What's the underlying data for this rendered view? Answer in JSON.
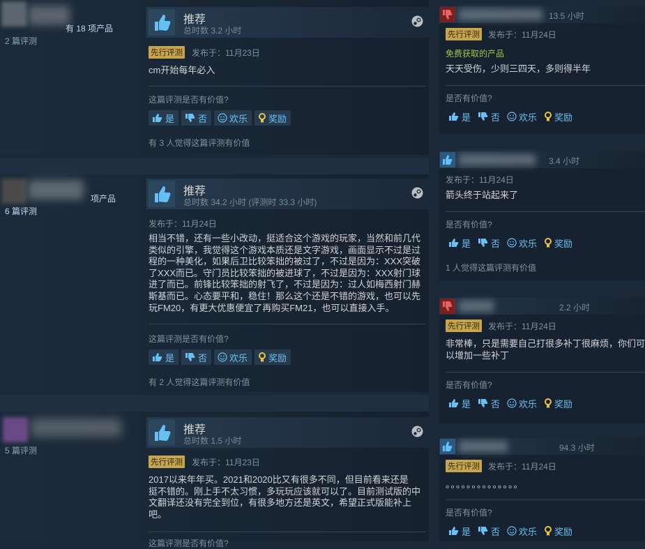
{
  "colors": {
    "accent": "#67c1f5",
    "early_access": "#c6a54e",
    "free": "#a4c34d",
    "thumb_up": "#2a5a82",
    "thumb_down": "#7a1f1f"
  },
  "left_reviews": [
    {
      "author_nick": "有 18 项产品",
      "review_count": "2 篇评测",
      "recommendation": "推荐",
      "hours": "总时数 3.2 小时",
      "early_access": "先行评测",
      "posted": "发布于：11月23日",
      "body": [
        "cm开始每年必入"
      ],
      "helpful_question": "这篇评测是否有价值?",
      "buttons": {
        "yes": "是",
        "no": "否",
        "funny": "欢乐",
        "award": "奖励"
      },
      "helpful_count": "有 3 人觉得这篇评测有价值"
    },
    {
      "author_nick": "项产品",
      "review_count": "6 篇评测",
      "recommendation": "推荐",
      "hours": "总时数 34.2 小时   (评测时 33.3 小时)",
      "early_access": "",
      "posted": "发布于：11月24日",
      "body": [
        "相当不错，还有一些小改动，挺适合这个游戏的玩家，当然和前几代",
        "类似的引擎，我觉得这个游戏本质还是文字游戏，画面显示不过是过",
        "程的一种美化，如果后卫比较笨拙的被过了，不过是因为：XXX突破",
        "了XXX而已。守门员比较笨拙的被进球了，不过是因为：XXX射门球",
        "进了而已。前锋比较笨拙的射飞了，不过是因为：过人如梅西射门赫",
        "斯基而已。心态要平和，稳住！那么这个还是不错的游戏，也可以先",
        "玩FM20，有更大优惠便宜了再购买FM21，也可以直接入手。"
      ],
      "helpful_question": "这篇评测是否有价值?",
      "buttons": {
        "yes": "是",
        "no": "否",
        "funny": "欢乐",
        "award": "奖励"
      },
      "helpful_count": "有 2 人觉得这篇评测有价值"
    },
    {
      "author_nick": "",
      "review_count": "5 篇评测",
      "recommendation": "推荐",
      "hours": "总时数 1.5 小时",
      "early_access": "先行评测",
      "posted": "发布于：11月23日",
      "body": [
        "2017以来年年买。2021和2020比又有很多不同，但目前看来还是",
        "挺不错的。刚上手不太习惯，多玩玩应该就可以了。目前测试版的中",
        "文翻译还没有完全到位，有很多地方还是英文，希望正式版能补上",
        "吧。"
      ],
      "helpful_question": "这篇评测是否有价值?",
      "buttons": {
        "yes": "是",
        "no": "否",
        "funny": "欢乐",
        "award": "奖励"
      },
      "helpful_count": ""
    }
  ],
  "right_reviews": [
    {
      "thumb": "down",
      "hours": "13.5 小时",
      "early_access": "先行评测",
      "posted": "发布于：11月24日",
      "free_label": "免费获取的产品",
      "body": [
        "天天受伤，少则三四天，多则得半年"
      ],
      "helpful_question": "是否有价值?",
      "buttons": {
        "yes": "是",
        "no": "否",
        "funny": "欢乐",
        "award": "奖励"
      },
      "helpful_count": ""
    },
    {
      "thumb": "up",
      "hours": "3.4 小时",
      "early_access": "",
      "posted": "发布于：11月24日",
      "free_label": "",
      "body": [
        "箭头终于站起来了"
      ],
      "helpful_question": "是否有价值?",
      "buttons": {
        "yes": "是",
        "no": "否",
        "funny": "欢乐",
        "award": "奖励"
      },
      "helpful_count": "1 人觉得这篇评测有价值"
    },
    {
      "thumb": "down",
      "hours": "2.2 小时",
      "early_access": "先行评测",
      "posted": "发布于：11月24日",
      "free_label": "",
      "body": [
        "非常棒，只是需要自己打很多补丁很麻烦，你们可",
        "以增加一些补丁"
      ],
      "helpful_question": "是否有价值?",
      "buttons": {
        "yes": "是",
        "no": "否",
        "funny": "欢乐",
        "award": "奖励"
      },
      "helpful_count": ""
    },
    {
      "thumb": "up",
      "hours": "94.3 小时",
      "early_access": "先行评测",
      "posted": "发布于：11月24日",
      "free_label": "",
      "body": [
        "。。。。。。。。。。。。。。"
      ],
      "helpful_question": "是否有价值?",
      "buttons": {
        "yes": "是",
        "no": "否",
        "funny": "欢乐",
        "award": "奖励"
      },
      "helpful_count": ""
    }
  ]
}
